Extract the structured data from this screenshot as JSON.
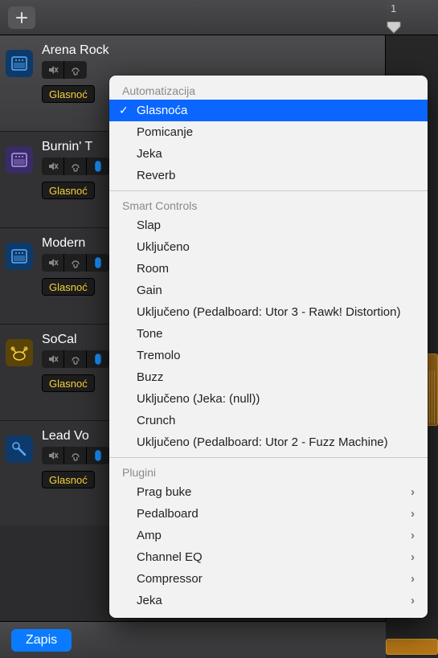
{
  "ruler": {
    "label": "1"
  },
  "tracks": [
    {
      "name": "Arena Rock",
      "pill": "Glasnoć",
      "icon_color": "#1793ff"
    },
    {
      "name": "Burnin' T",
      "pill": "Glasnoć",
      "icon_color": "#8e6cff"
    },
    {
      "name": "Modern",
      "pill": "Glasnoć",
      "icon_color": "#1793ff"
    },
    {
      "name": "SoCal",
      "pill": "Glasnoć",
      "icon_color": "#f8d23a"
    },
    {
      "name": "Lead Vo",
      "pill": "Glasnoć",
      "icon_color": "#1793ff"
    }
  ],
  "footer": {
    "record": "Zapis"
  },
  "menu": {
    "sec1_header": "Automatizacija",
    "sec1_items": [
      "Glasnoća",
      "Pomicanje",
      "Jeka",
      "Reverb"
    ],
    "sec1_selected_index": 0,
    "sec2_header": "Smart Controls",
    "sec2_items": [
      "Slap",
      "Uključeno",
      "Room",
      "Gain",
      "Uključeno (Pedalboard: Utor 3 - Rawk! Distortion)",
      "Tone",
      "Tremolo",
      "Buzz",
      "Uključeno (Jeka: (null))",
      "Crunch",
      "Uključeno (Pedalboard: Utor 2 - Fuzz Machine)"
    ],
    "sec3_header": "Plugini",
    "sec3_items": [
      "Prag buke",
      "Pedalboard",
      "Amp",
      "Channel EQ",
      "Compressor",
      "Jeka"
    ]
  }
}
